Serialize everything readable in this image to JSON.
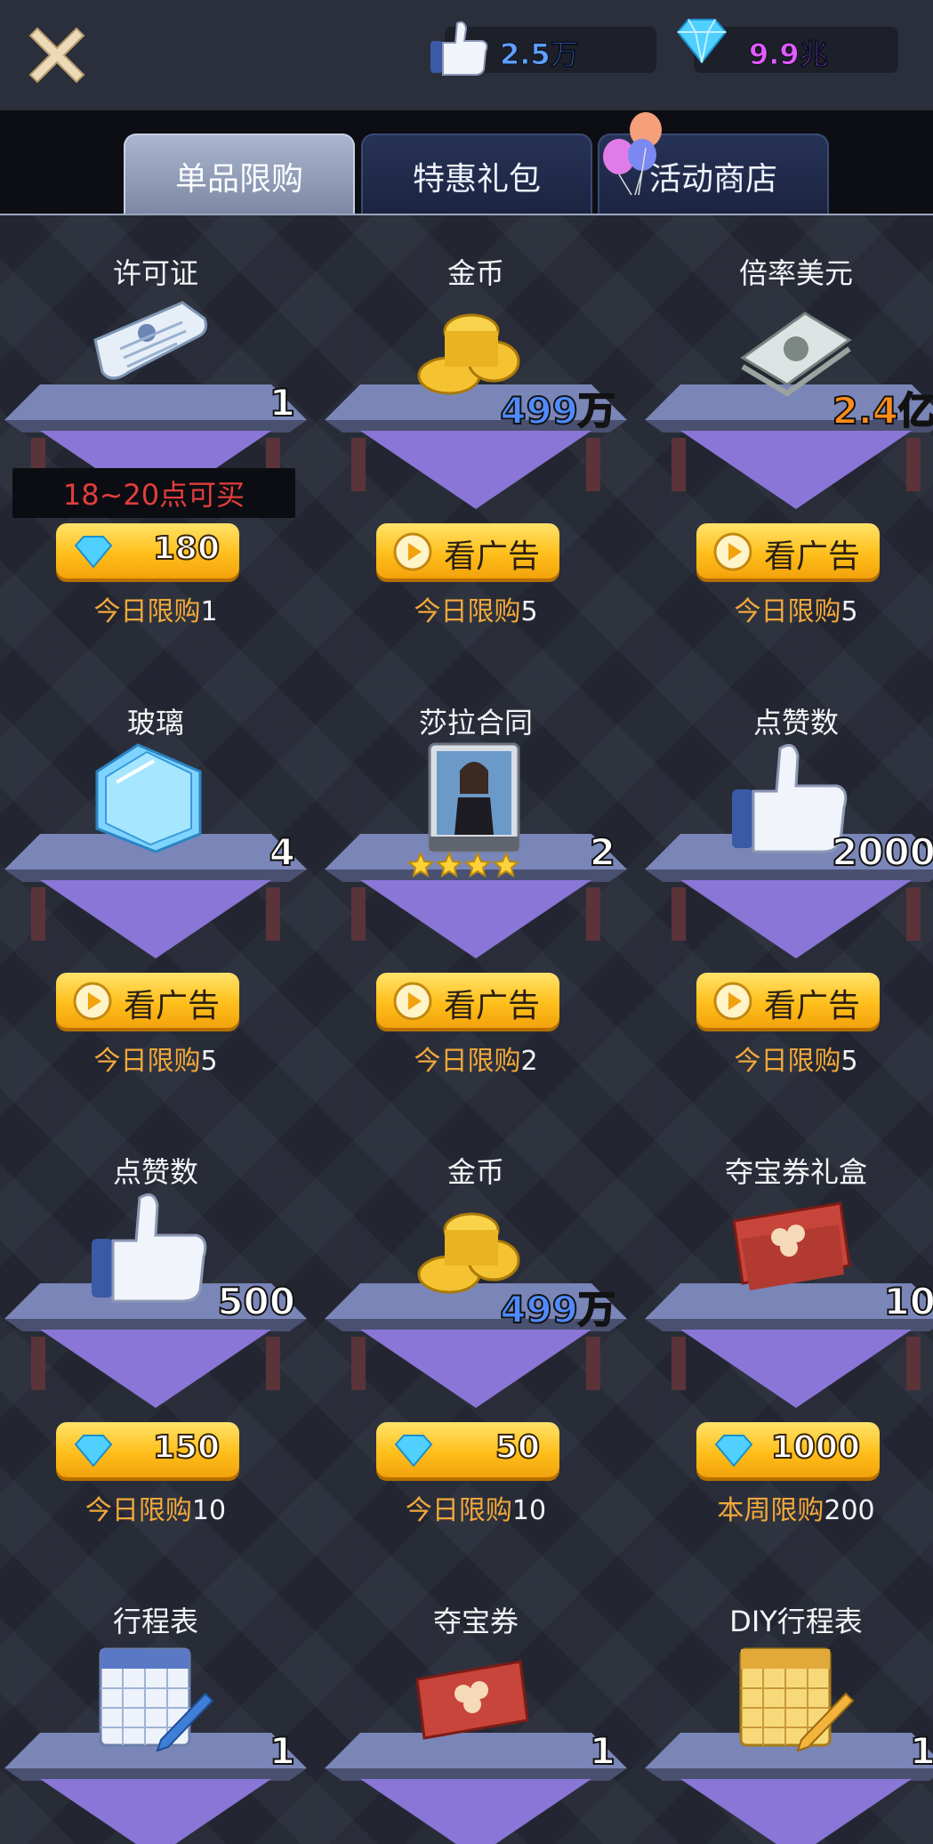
{
  "header": {
    "likes": "2.5万",
    "gems": "9.9兆"
  },
  "tabs": [
    "单品限购",
    "特惠礼包",
    "活动商店"
  ],
  "colors": {
    "button": "#ffbf1c",
    "limit_label": "#f2a83a",
    "restrict_text": "#e23d3d"
  },
  "items": [
    {
      "name": "许可证",
      "icon": "license-icon",
      "count": "1",
      "restrict": "18~20点可买",
      "price": "180",
      "limit_label": "今日限购",
      "limit_value": "1"
    },
    {
      "name": "金币",
      "icon": "gold-coins-icon",
      "count": "499万",
      "ad": "看广告",
      "limit_label": "今日限购",
      "limit_value": "5"
    },
    {
      "name": "倍率美元",
      "icon": "dollar-stack-icon",
      "count": "2.4亿",
      "ad": "看广告",
      "limit_label": "今日限购",
      "limit_value": "5"
    },
    {
      "name": "玻璃",
      "icon": "glass-panes-icon",
      "count": "4",
      "ad": "看广告",
      "limit_label": "今日限购",
      "limit_value": "5"
    },
    {
      "name": "莎拉合同",
      "icon": "contract-card-icon",
      "count": "2",
      "ad": "看广告",
      "limit_label": "今日限购",
      "limit_value": "2"
    },
    {
      "name": "点赞数",
      "icon": "thumbs-up-icon",
      "count": "2000",
      "ad": "看广告",
      "limit_label": "今日限购",
      "limit_value": "5"
    },
    {
      "name": "点赞数",
      "icon": "thumbs-up-icon",
      "count": "500",
      "price": "150",
      "limit_label": "今日限购",
      "limit_value": "10"
    },
    {
      "name": "金币",
      "icon": "gold-coins-icon",
      "count": "499万",
      "price": "50",
      "limit_label": "今日限购",
      "limit_value": "10"
    },
    {
      "name": "夺宝券礼盒",
      "icon": "treasure-ticket-box-icon",
      "count": "10",
      "price": "1000",
      "limit_label": "本周限购",
      "limit_value": "200"
    },
    {
      "name": "行程表",
      "icon": "calendar-icon",
      "count": "1"
    },
    {
      "name": "夺宝券",
      "icon": "treasure-ticket-icon",
      "count": "1"
    },
    {
      "name": "DIY行程表",
      "icon": "diy-calendar-icon",
      "count": "1"
    }
  ]
}
